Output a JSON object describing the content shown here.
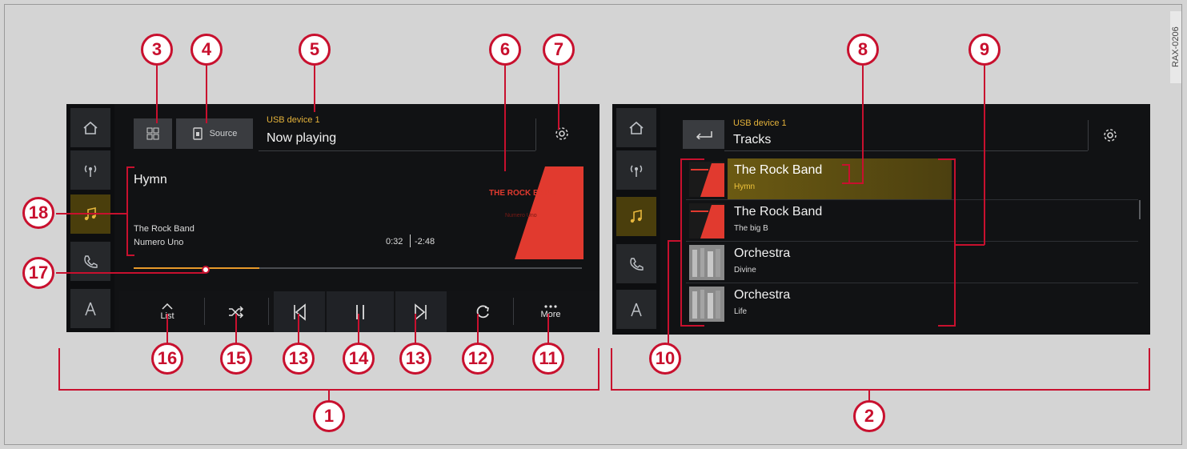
{
  "figure_code": "RAX-0206",
  "callouts": {
    "c1": "1",
    "c2": "2",
    "c3": "3",
    "c4": "4",
    "c5": "5",
    "c6": "6",
    "c7": "7",
    "c8": "8",
    "c9": "9",
    "c10": "10",
    "c11": "11",
    "c12": "12",
    "c13a": "13",
    "c13b": "13",
    "c14": "14",
    "c15": "15",
    "c16": "16",
    "c17": "17",
    "c18": "18"
  },
  "sidebar": {
    "items": [
      {
        "icon": "home-icon"
      },
      {
        "icon": "radio-icon"
      },
      {
        "icon": "music-note-icon",
        "active": true
      },
      {
        "icon": "phone-icon"
      },
      {
        "icon": "navigation-icon"
      }
    ]
  },
  "now_playing": {
    "source_label": "Source",
    "device": "USB device 1",
    "title": "Now playing",
    "track": "Hymn",
    "artist": "The Rock Band",
    "album": "Numero Uno",
    "elapsed": "0:32",
    "remaining": "-2:48",
    "progress": 0.28,
    "cover_text": "THE ROCK BAND",
    "cover_subtext": "Numero Uno"
  },
  "controls": {
    "list_label": "List",
    "more_label": "More",
    "items": [
      "chevron-up-icon",
      "shuffle-icon",
      "skip-back-icon",
      "pause-icon",
      "skip-forward-icon",
      "repeat-icon",
      "more-dots-icon"
    ]
  },
  "tracks_screen": {
    "device": "USB device 1",
    "title": "Tracks",
    "rows": [
      {
        "title": "The Rock Band",
        "subtitle": "Hymn",
        "selected": true
      },
      {
        "title": "The Rock Band",
        "subtitle": "The big B"
      },
      {
        "title": "Orchestra",
        "subtitle": "Divine"
      },
      {
        "title": "Orchestra",
        "subtitle": "Life"
      }
    ]
  },
  "colors": {
    "accent_yellow": "#e4b23a",
    "callout_red": "#c8102e",
    "progress_orange": "#e89a2a",
    "screen_bg": "#111214"
  }
}
